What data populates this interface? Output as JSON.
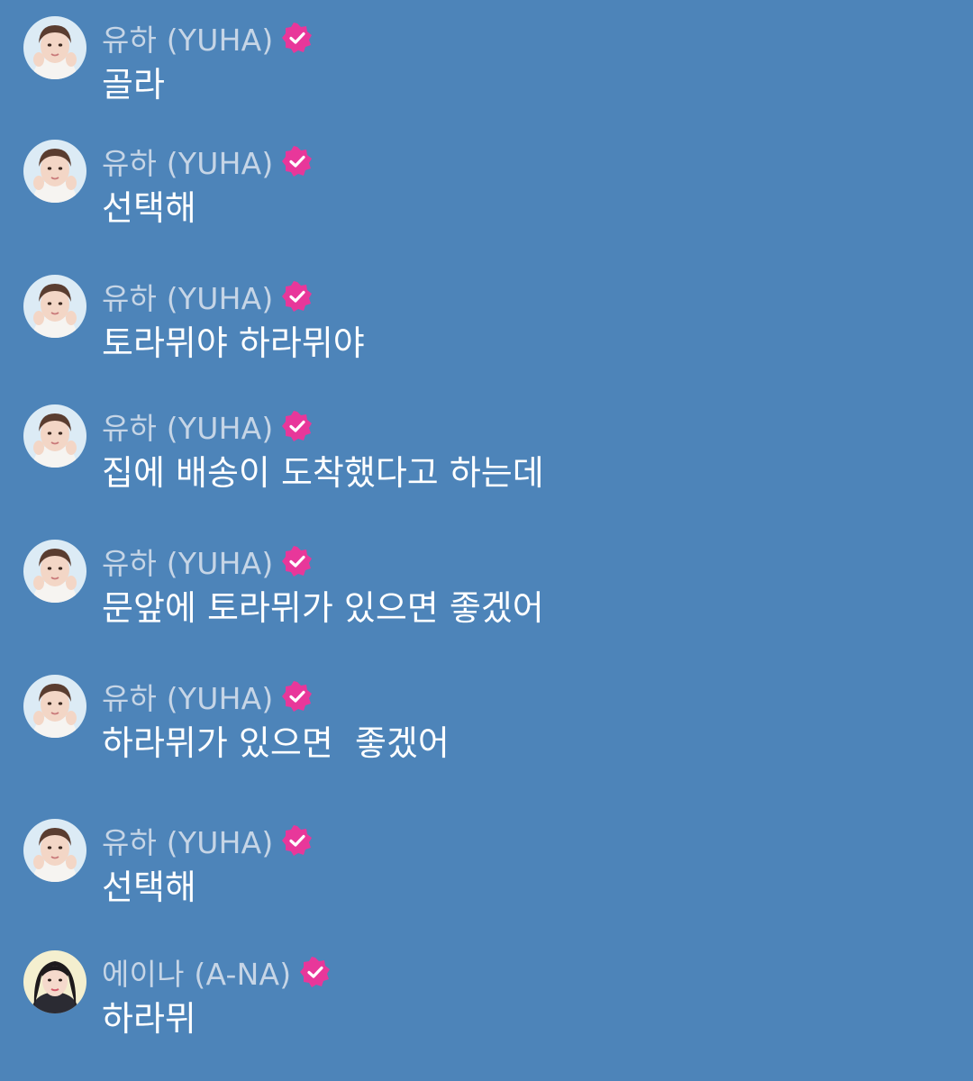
{
  "colors": {
    "background": "#4d84b9",
    "sender_name": "#c6d5e6",
    "message_text": "#ffffff",
    "verified_badge": "#e8379a"
  },
  "messages": [
    {
      "sender": "유하 (YUHA)",
      "text": "골라",
      "avatar_icon": "yuha-avatar-icon",
      "verified": true
    },
    {
      "sender": "유하 (YUHA)",
      "text": "선택해",
      "avatar_icon": "yuha-avatar-icon",
      "verified": true
    },
    {
      "sender": "유하 (YUHA)",
      "text": "토라뮈야 하라뮈야",
      "avatar_icon": "yuha-avatar-icon",
      "verified": true
    },
    {
      "sender": "유하 (YUHA)",
      "text": "집에 배송이 도착했다고 하는데",
      "avatar_icon": "yuha-avatar-icon",
      "verified": true
    },
    {
      "sender": "유하 (YUHA)",
      "text": "문앞에 토라뮈가 있으면 좋겠어",
      "avatar_icon": "yuha-avatar-icon",
      "verified": true
    },
    {
      "sender": "유하 (YUHA)",
      "text": "하라뮈가 있으면  좋겠어",
      "avatar_icon": "yuha-avatar-icon",
      "verified": true
    },
    {
      "sender": "유하 (YUHA)",
      "text": "선택해",
      "avatar_icon": "yuha-avatar-icon",
      "verified": true
    },
    {
      "sender": "에이나 (A-NA)",
      "text": "하라뮈",
      "avatar_icon": "ana-avatar-icon",
      "verified": true
    }
  ]
}
